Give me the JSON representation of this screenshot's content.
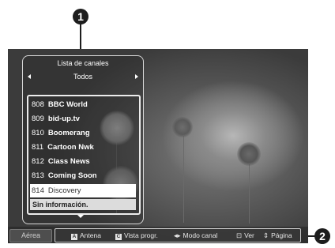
{
  "callouts": [
    "1",
    "2"
  ],
  "channel_list": {
    "title": "Lista de canales",
    "group": "Todos",
    "channels": [
      {
        "number": "808",
        "name": "BBC World"
      },
      {
        "number": "809",
        "name": "bid-up.tv"
      },
      {
        "number": "810",
        "name": "Boomerang"
      },
      {
        "number": "811",
        "name": "Cartoon Nwk"
      },
      {
        "number": "812",
        "name": "Class News"
      },
      {
        "number": "813",
        "name": "Coming Soon"
      },
      {
        "number": "814",
        "name": "Discovery"
      }
    ],
    "selected_channel": "814",
    "info_text": "Sin información."
  },
  "bottom_bar": {
    "mode_label": "Aérea",
    "hints": [
      {
        "key": "A",
        "label": "Antena"
      },
      {
        "key": "C",
        "label": "Vista progr."
      },
      {
        "glyph": "◂▸",
        "label": "Modo canal"
      },
      {
        "glyph": "⊡",
        "label": "Ver"
      },
      {
        "glyph": "⇕",
        "label": "Página"
      }
    ]
  },
  "icons": {
    "left_arrow": "triangle-left",
    "right_arrow": "triangle-right",
    "scroll_down": "triangle-down"
  }
}
